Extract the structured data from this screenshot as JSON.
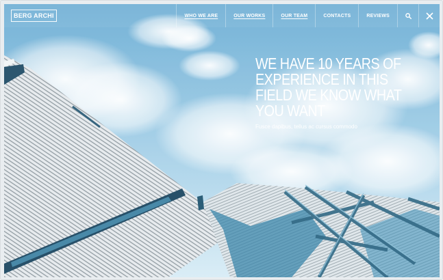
{
  "brand": {
    "logo_text": "BERG ARCHI"
  },
  "nav": {
    "items": [
      {
        "label": "WHO WE ARE"
      },
      {
        "label": "OUR WORKS"
      },
      {
        "label": "OUR TEAM"
      },
      {
        "label": "CONTACTS"
      },
      {
        "label": "REVIEWS"
      }
    ],
    "icons": [
      "search-icon",
      "close-icon"
    ]
  },
  "hero": {
    "headline_lines": [
      "WE HAVE 10 YEARS OF",
      "EXPERIENCE IN THIS",
      "FIELD WE KNOW WHAT",
      "YOU WANT"
    ],
    "subtext": "Fusce dapibus, tellus ac cursus commodo"
  },
  "colors": {
    "sky": "#8cc2e0",
    "text": "#ffffff",
    "glass": "#2f7fa6"
  }
}
